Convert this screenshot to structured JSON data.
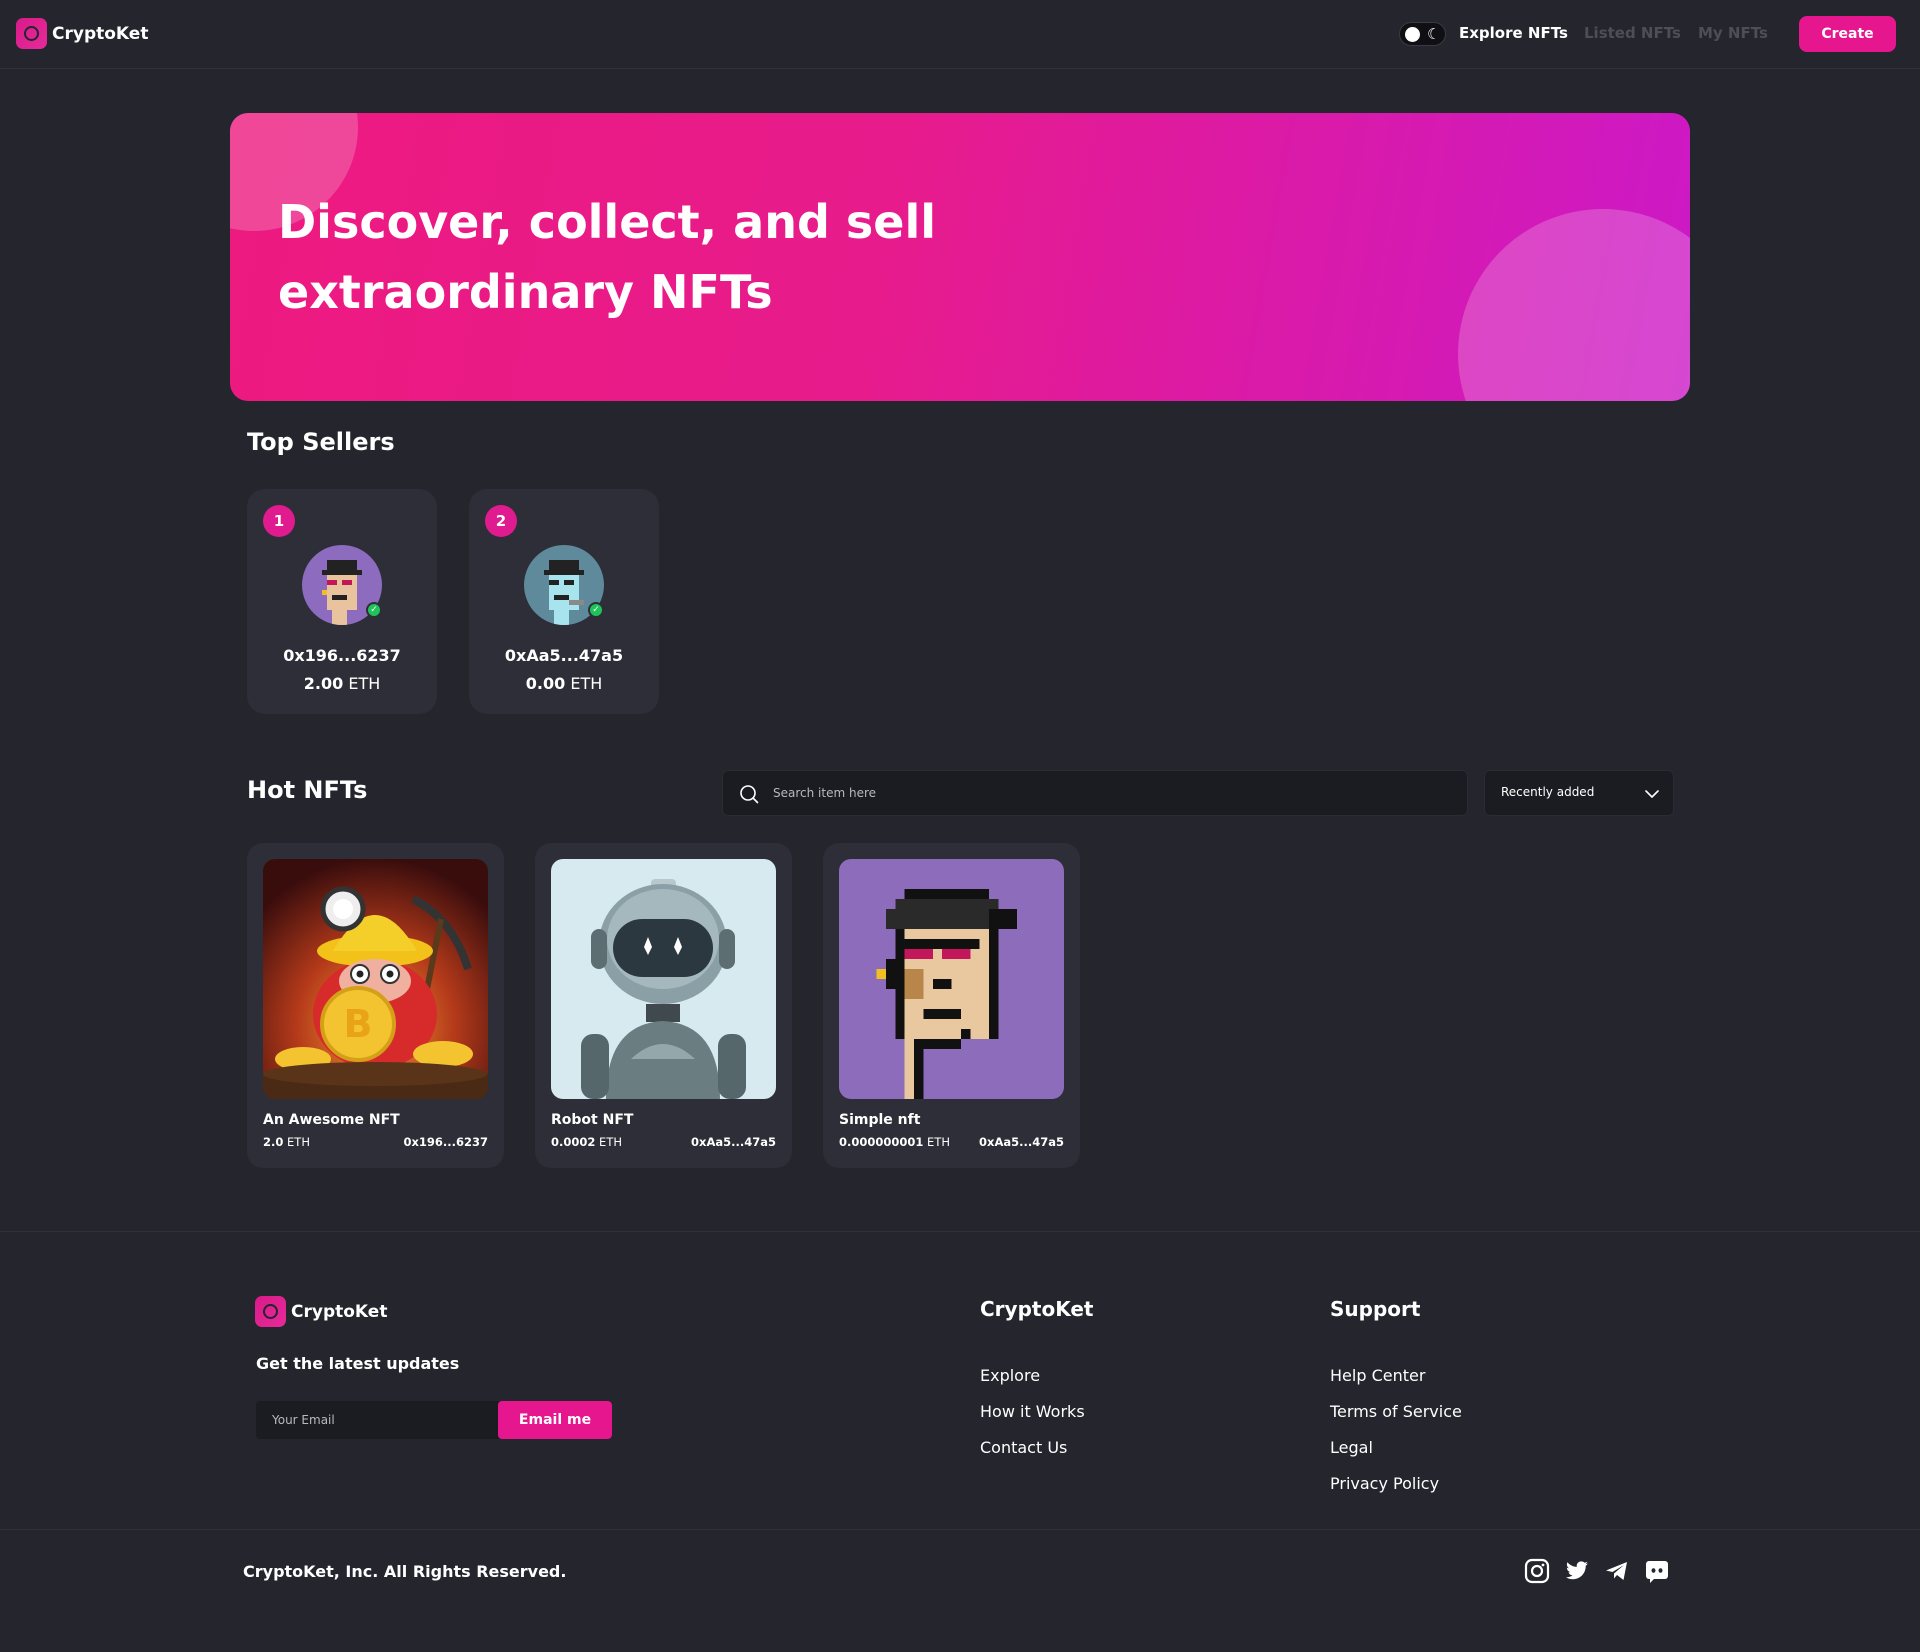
{
  "brand": {
    "name": "CryptoKet"
  },
  "nav": {
    "links": [
      {
        "label": "Explore NFTs",
        "active": true
      },
      {
        "label": "Listed NFTs",
        "active": false
      },
      {
        "label": "My NFTs",
        "active": false
      }
    ],
    "create_label": "Create",
    "theme_toggle_icon": "moon-icon"
  },
  "hero": {
    "line1": "Discover, collect, and sell",
    "line2": "extraordinary NFTs"
  },
  "top_sellers": {
    "title": "Top Sellers",
    "items": [
      {
        "rank": "1",
        "address": "0x196...6237",
        "amount": "2.00",
        "unit": "ETH"
      },
      {
        "rank": "2",
        "address": "0xAa5...47a5",
        "amount": "0.00",
        "unit": "ETH"
      }
    ]
  },
  "hot_nfts": {
    "title": "Hot NFTs",
    "search_placeholder": "Search item here",
    "sort_selected": "Recently added",
    "items": [
      {
        "name": "An Awesome NFT",
        "price": "2.0",
        "unit": "ETH",
        "owner": "0x196...6237",
        "image": "miner-mole-bitcoin"
      },
      {
        "name": "Robot NFT",
        "price": "0.0002",
        "unit": "ETH",
        "owner": "0xAa5...47a5",
        "image": "astronaut-robot"
      },
      {
        "name": "Simple nft",
        "price": "0.000000001",
        "unit": "ETH",
        "owner": "0xAa5...47a5",
        "image": "pixel-punk"
      }
    ]
  },
  "footer": {
    "brand": "CryptoKet",
    "updates_title": "Get the latest updates",
    "email_placeholder": "Your Email",
    "email_button": "Email me",
    "columns": [
      {
        "title": "CryptoKet",
        "links": [
          "Explore",
          "How it Works",
          "Contact Us"
        ]
      },
      {
        "title": "Support",
        "links": [
          "Help Center",
          "Terms of Service",
          "Legal",
          "Privacy Policy"
        ]
      }
    ],
    "copyright": "CryptoKet, Inc. All Rights Reserved.",
    "social_icons": [
      "instagram-icon",
      "twitter-icon",
      "telegram-icon",
      "discord-icon"
    ]
  },
  "colors": {
    "accent": "#e6168e",
    "background": "#24252d",
    "card": "#2d2e37",
    "input": "#1b1c22"
  }
}
